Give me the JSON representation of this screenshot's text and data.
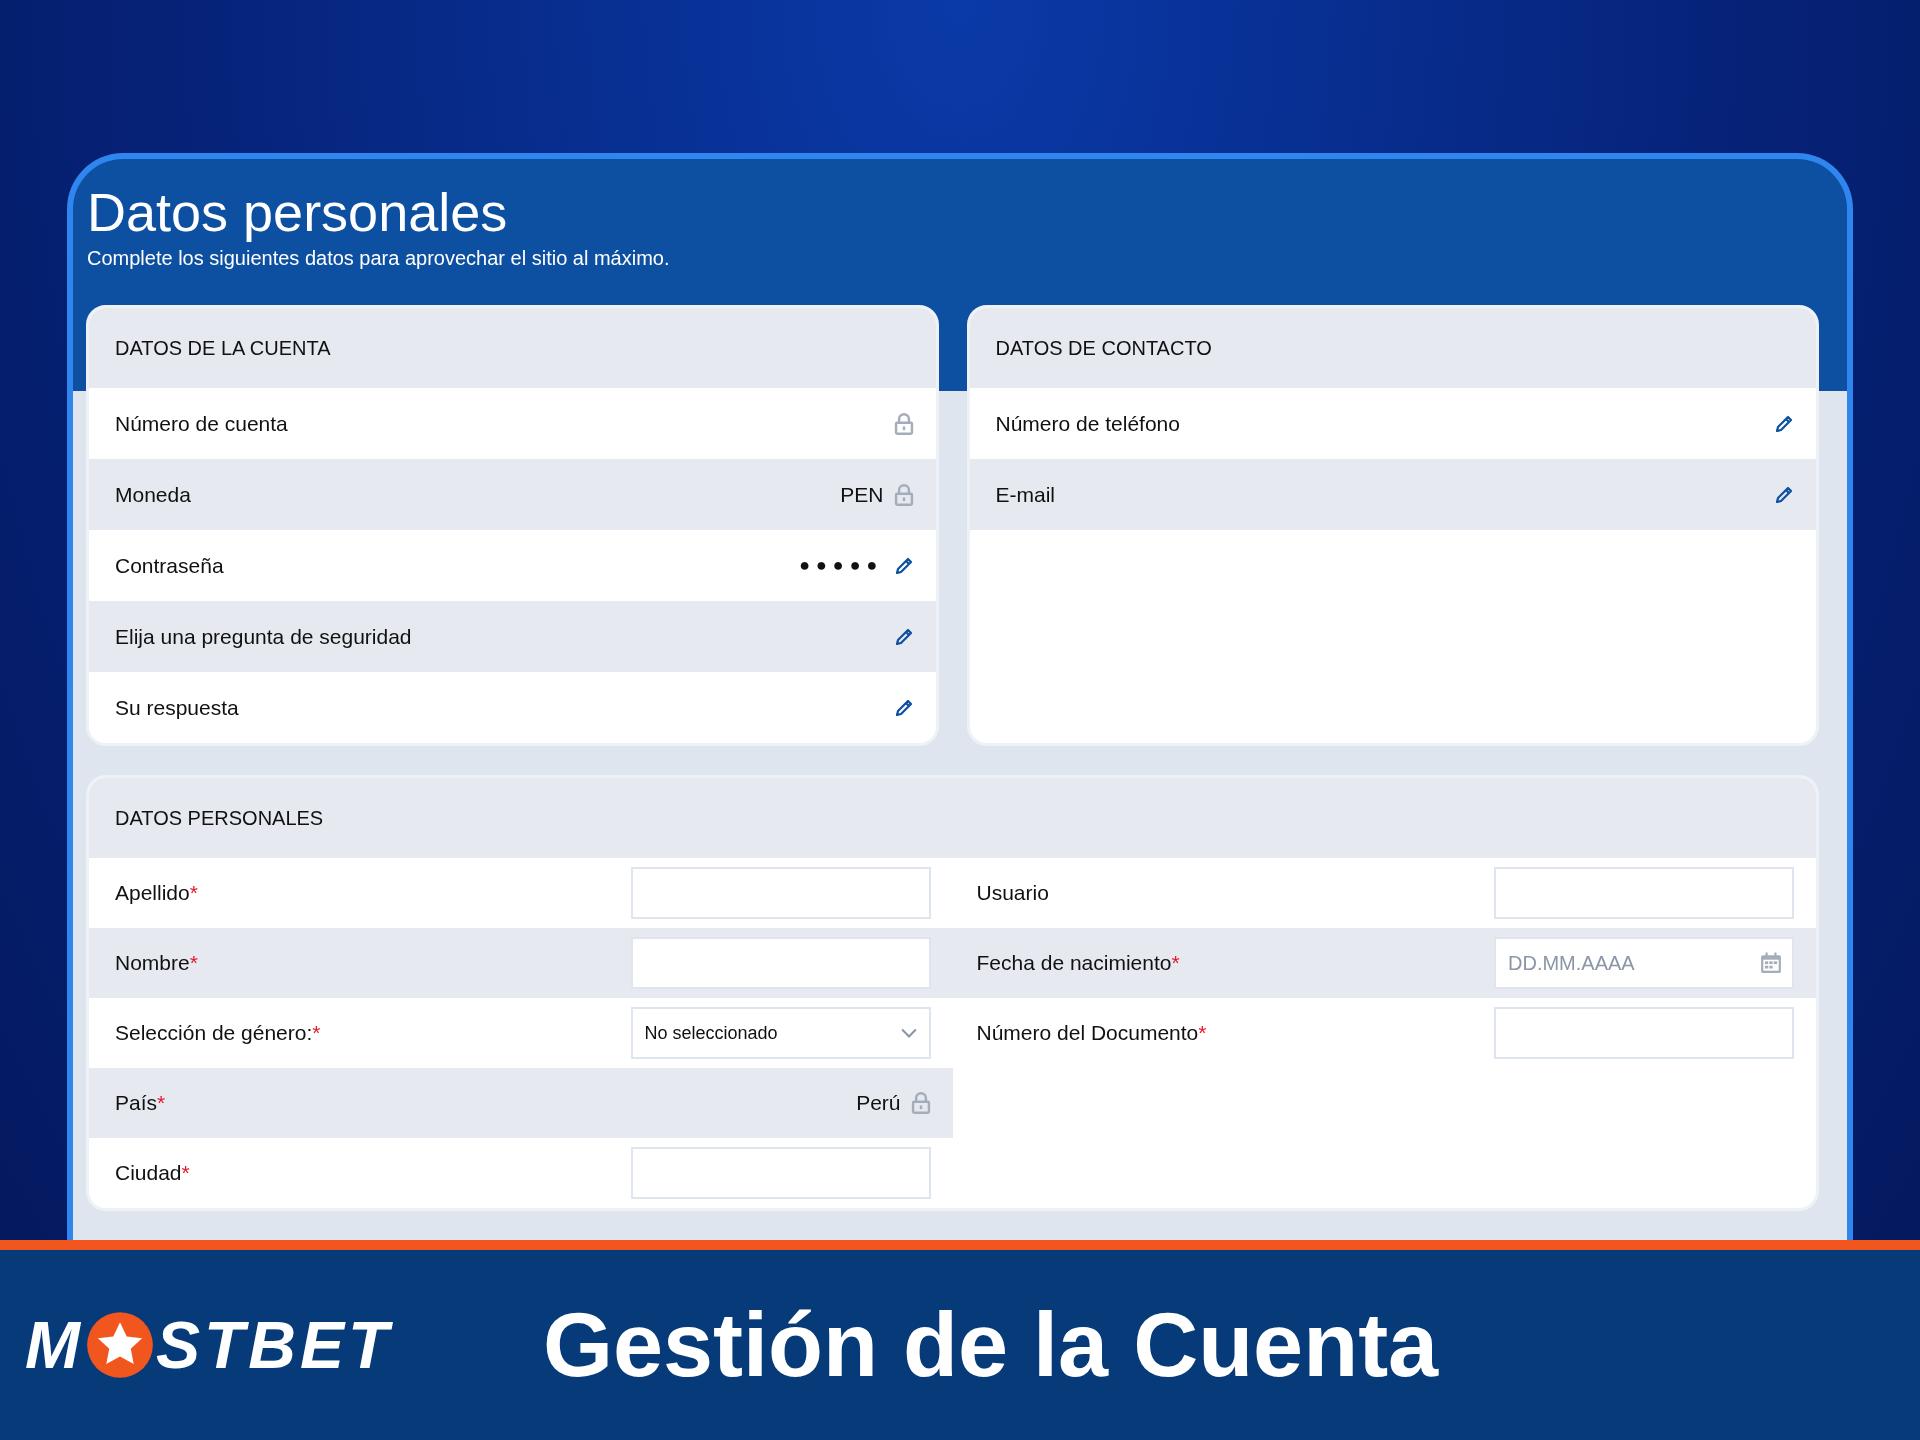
{
  "page": {
    "title": "Datos personales",
    "subtitle": "Complete los siguientes datos para aprovechar el sitio al máximo."
  },
  "account": {
    "heading": "DATOS DE LA CUENTA",
    "rows": [
      {
        "label": "Número de cuenta",
        "kind": "locked"
      },
      {
        "label": "Moneda",
        "value": "PEN",
        "kind": "locked"
      },
      {
        "label": "Contraseña",
        "value": "●●●●●",
        "kind": "editable"
      },
      {
        "label": "Elija una pregunta de seguridad",
        "kind": "editable"
      },
      {
        "label": "Su respuesta",
        "kind": "editable"
      }
    ]
  },
  "contact": {
    "heading": "DATOS DE CONTACTO",
    "rows": [
      {
        "label": "Número de teléfono",
        "kind": "editable"
      },
      {
        "label": "E-mail",
        "kind": "editable"
      }
    ]
  },
  "personal": {
    "heading": "DATOS PERSONALES",
    "columns": [
      [
        {
          "label": "Apellido",
          "required_mark": "*",
          "kind": "input"
        },
        {
          "label": "Nombre",
          "required_mark": "*",
          "kind": "input"
        },
        {
          "label": "Selección de género:",
          "required_mark": "*",
          "kind": "select",
          "value": "No seleccionado"
        },
        {
          "label": "País",
          "required_mark": "*",
          "kind": "locked",
          "value": "Perú"
        },
        {
          "label": "Ciudad",
          "required_mark": "*",
          "kind": "input"
        }
      ],
      [
        {
          "label": "Usuario",
          "kind": "input"
        },
        {
          "label": "Fecha de nacimiento",
          "required_mark": "*",
          "kind": "date",
          "placeholder": "DD.MM.AAAA"
        },
        {
          "label": "Número del Documento",
          "required_mark": "*",
          "kind": "input"
        }
      ]
    ]
  },
  "footer": {
    "logo_start": "M",
    "logo_end": "STBET",
    "caption": "Gestión de la Cuenta"
  }
}
